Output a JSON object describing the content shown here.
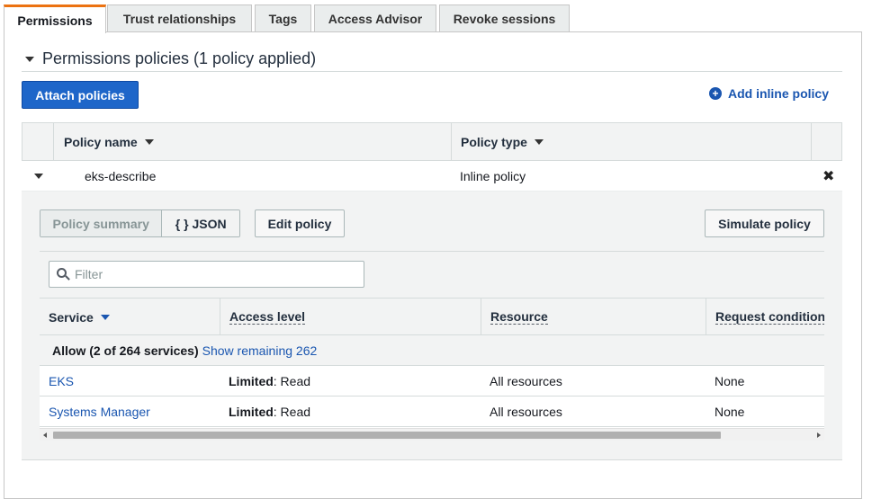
{
  "tabs": [
    {
      "label": "Permissions",
      "active": true
    },
    {
      "label": "Trust relationships",
      "active": false
    },
    {
      "label": "Tags",
      "active": false
    },
    {
      "label": "Access Advisor",
      "active": false
    },
    {
      "label": "Revoke sessions",
      "active": false
    }
  ],
  "section": {
    "title": "Permissions policies (1 policy applied)",
    "attach_label": "Attach policies",
    "add_inline_label": "Add inline policy"
  },
  "policies_table": {
    "headers": {
      "name": "Policy name",
      "type": "Policy type"
    },
    "rows": [
      {
        "name": "eks-describe",
        "type": "Inline policy"
      }
    ]
  },
  "detail": {
    "view_toggle": {
      "summary": "Policy summary",
      "json": "{ } JSON",
      "selected": "Policy summary"
    },
    "edit_label": "Edit policy",
    "simulate_label": "Simulate policy",
    "filter_placeholder": "Filter",
    "headers": {
      "service": "Service",
      "access_level": "Access level",
      "resource": "Resource",
      "request_condition": "Request condition"
    },
    "allow_summary": "Allow (2 of 264 services)",
    "show_remaining": "Show remaining 262",
    "services": [
      {
        "service": "EKS",
        "access_bold": "Limited",
        "access_rest": ": Read",
        "resource": "All resources",
        "condition": "None"
      },
      {
        "service": "Systems Manager",
        "access_bold": "Limited",
        "access_rest": ": Read",
        "resource": "All resources",
        "condition": "None"
      }
    ]
  },
  "colors": {
    "primary": "#1e66c9",
    "link": "#1a56b0",
    "active_tab_accent": "#ec7211"
  }
}
